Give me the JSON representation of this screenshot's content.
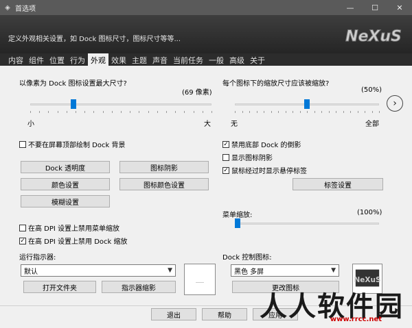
{
  "window": {
    "title": "首选项",
    "buttons": {
      "minimize": "—",
      "maximize": "☐",
      "close": "✕"
    }
  },
  "header": {
    "subtitle": "定义外观相关设置，如 Dock 图标尺寸，图标尺寸等等...",
    "logo_text": "NeXuS"
  },
  "tabs": [
    {
      "label": "内容"
    },
    {
      "label": "组件"
    },
    {
      "label": "位置"
    },
    {
      "label": "行为"
    },
    {
      "label": "外观",
      "active": true
    },
    {
      "label": "效果"
    },
    {
      "label": "主题"
    },
    {
      "label": "声音"
    },
    {
      "label": "当前任务"
    },
    {
      "label": "一般"
    },
    {
      "label": "高级"
    },
    {
      "label": "关于"
    }
  ],
  "left": {
    "icon_size": {
      "label": "以像素为 Dock 图标设置最大尺寸?",
      "value_text": "(69 像素)",
      "value_fraction": 0.24,
      "min_label": "小",
      "max_label": "大"
    },
    "no_background_check": {
      "label": "不要在屏幕顶部绘制 Dock 背景",
      "checked": false
    },
    "buttons": {
      "dock_transparency": "Dock 透明度",
      "icon_reflection": "图标阴影",
      "color_settings": "颜色设置",
      "icon_color_settings": "图标颜色设置",
      "blur_settings": "模糊设置"
    },
    "dpi_menu_check": {
      "label": "在高 DPI 设置上禁用菜单缩放",
      "checked": false
    },
    "dpi_dock_check": {
      "label": "在高 DPI 设置上禁用 Dock 缩放",
      "checked": true
    },
    "running_indicator": {
      "label": "运行指示器:",
      "selected": "默认",
      "open_folder": "打开文件夹",
      "indicator_effect": "指示器缩影"
    }
  },
  "right": {
    "zoom": {
      "label": "每个图标下的缩放尺寸应该被缩放?",
      "value_text": "(50%)",
      "value_fraction": 0.5,
      "min_label": "无",
      "max_label": "全部"
    },
    "disable_checks": [
      {
        "label": "禁用底部 Dock 的倒影",
        "checked": true
      },
      {
        "label": "显示图标阴影",
        "checked": false
      },
      {
        "label": "鼠标经过时显示悬停标签",
        "checked": true
      }
    ],
    "label_settings": "标签设置",
    "menu_zoom": {
      "label": "菜单缩放:",
      "value_text": "(100%)",
      "value_fraction": 0.0
    },
    "dock_control": {
      "label": "Dock 控制图标:",
      "selected": "黑色 多屏",
      "change_icon": "更改图标"
    }
  },
  "footer": {
    "close": "退出",
    "help": "帮助",
    "apply": "应用"
  },
  "watermark": {
    "text": "人人软件园",
    "url": "www.rrcc.net"
  },
  "next_icon": "›"
}
